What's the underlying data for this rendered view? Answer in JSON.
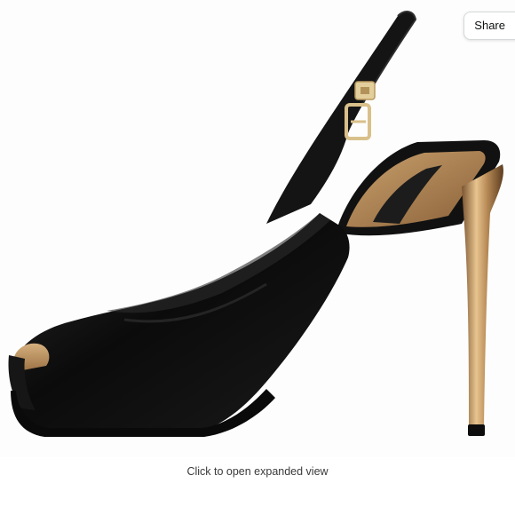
{
  "toolbar": {
    "share_label": "Share"
  },
  "image": {
    "subject": "black satin peep-toe slingback stiletto pump with gold metallic heel and gold buckle"
  },
  "caption": {
    "text": "Click to open expanded view"
  },
  "colors": {
    "shoe_black": "#111111",
    "heel_gold": "#b48a55",
    "buckle_gold": "#d9c08a",
    "background": "#ffffff"
  }
}
